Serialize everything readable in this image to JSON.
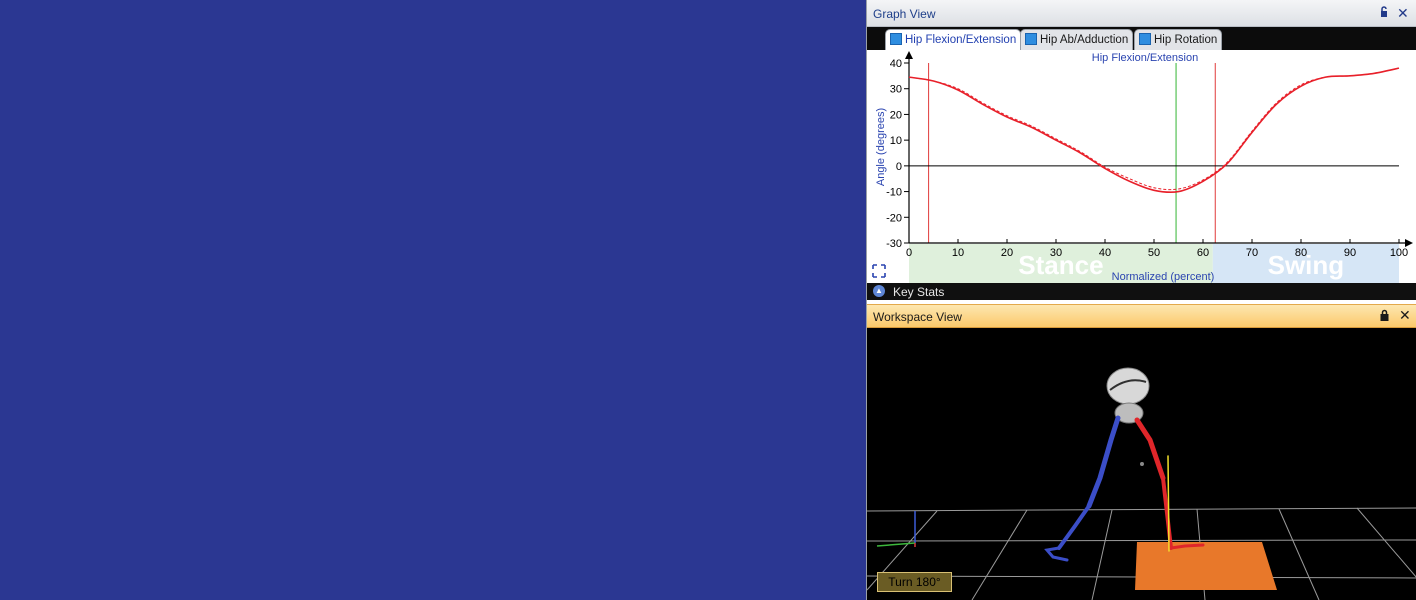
{
  "graph_view": {
    "title": "Graph View",
    "pin_icon": "pin-icon",
    "close_icon": "close-icon",
    "tabs": [
      {
        "label": "Hip Flexion/Extension",
        "active": true
      },
      {
        "label": "Hip Ab/Adduction",
        "active": false
      },
      {
        "label": "Hip Rotation",
        "active": false
      }
    ],
    "expand_icon": "expand-icon"
  },
  "chart_data": {
    "type": "line",
    "title": "Hip Flexion/Extension",
    "xlabel": "Normalized (percent)",
    "ylabel": "Angle (degrees)",
    "xlim": [
      0,
      100
    ],
    "ylim": [
      -30,
      40
    ],
    "x_ticks": [
      0,
      10,
      20,
      30,
      40,
      50,
      60,
      70,
      80,
      90,
      100
    ],
    "y_ticks": [
      40,
      30,
      20,
      10,
      0,
      -10,
      -20,
      -30
    ],
    "phases": [
      {
        "label": "Stance",
        "start": 0,
        "end": 62,
        "color": "#dff0dc"
      },
      {
        "label": "Swing",
        "start": 62,
        "end": 100,
        "color": "#d6e6f6"
      }
    ],
    "markers": [
      {
        "x": 4,
        "color": "#e03a3a"
      },
      {
        "x": 54.5,
        "color": "#33b533"
      },
      {
        "x": 62.5,
        "color": "#e03a3a"
      }
    ],
    "zero_line": true,
    "series": [
      {
        "color": "#e8202a",
        "style": "solid",
        "x": [
          0,
          5,
          10,
          15,
          20,
          25,
          30,
          35,
          40,
          45,
          50,
          55,
          60,
          65,
          70,
          75,
          80,
          85,
          90,
          95,
          100
        ],
        "y": [
          34.5,
          33,
          29.5,
          24,
          19,
          15,
          10,
          5,
          -1,
          -6,
          -9.5,
          -10,
          -6,
          1,
          13,
          24,
          31,
          34.5,
          35,
          36,
          38
        ]
      },
      {
        "color": "#e8202a",
        "style": "dashed",
        "x": [
          0,
          5,
          10,
          15,
          20,
          25,
          30,
          35,
          40,
          45,
          50,
          55,
          60,
          65,
          70,
          75,
          80,
          85,
          90,
          95,
          100
        ],
        "y": [
          34.5,
          33,
          30,
          24.5,
          19.5,
          15.5,
          10.5,
          5.5,
          -0.5,
          -5,
          -8.5,
          -9,
          -5.5,
          1.5,
          13.5,
          24.5,
          31.5,
          34.5,
          35,
          36,
          38
        ]
      }
    ]
  },
  "key_stats": {
    "label": "Key Stats",
    "icon": "collapse-up-icon"
  },
  "workspace_view": {
    "title": "Workspace View",
    "lock_icon": "lock-icon",
    "close_icon": "close-icon",
    "turn_button": "Turn 180°"
  },
  "colors": {
    "background": "#2b3792",
    "left_leg": "#3b4ec8",
    "right_leg": "#e0262a",
    "force_plate": "#e8782a"
  }
}
